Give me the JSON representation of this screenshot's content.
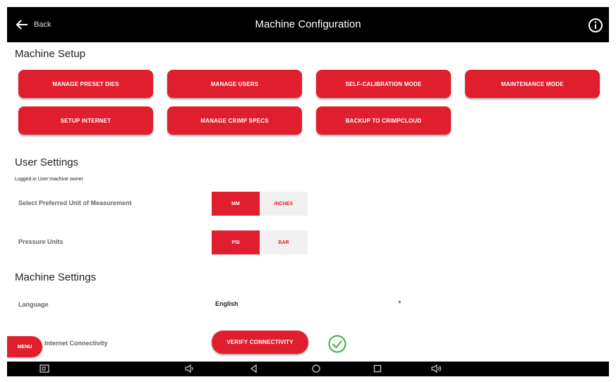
{
  "header": {
    "back_label": "Back",
    "title": "Machine Configuration"
  },
  "machine_setup": {
    "title": "Machine Setup",
    "buttons": [
      "MANAGE PRESET DIES",
      "MANAGE USERS",
      "SELF-CALIBRATION MODE",
      "MAINTENANCE MODE",
      "SETUP INTERNET",
      "MANAGE CRIMP SPECS",
      "BACKUP TO CRIMPCLOUD"
    ]
  },
  "user_settings": {
    "title": "User Settings",
    "logged_in": "Logged in User:machine owner",
    "unit_label": "Select Preferred Unit of Measurement",
    "unit_options": [
      "MM",
      "INCHES"
    ],
    "unit_selected": "MM",
    "pressure_label": "Pressure Units",
    "pressure_options": [
      "PSI",
      "BAR"
    ],
    "pressure_selected": "PSI"
  },
  "machine_settings": {
    "title": "Machine Settings",
    "language_label": "Language",
    "language_value": "English",
    "internet_label": "Internet Connectivity",
    "verify_button": "VERIFY CONNECTIVITY",
    "connectivity_status": "connected"
  },
  "menu_label": "MENU",
  "colors": {
    "accent": "#e11e2d",
    "bar": "#000000",
    "success": "#3cb043"
  }
}
